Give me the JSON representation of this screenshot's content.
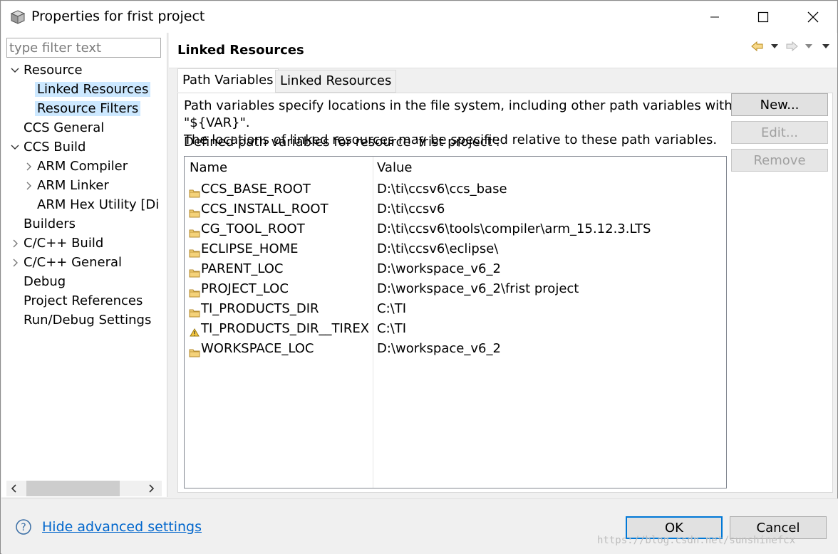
{
  "window": {
    "title": "Properties for frist project",
    "icon": "app-cube-icon"
  },
  "filter": {
    "placeholder": "type filter text"
  },
  "tree": [
    {
      "label": "Resource",
      "expander": "expanded"
    },
    {
      "label": "Linked Resources",
      "selected": true
    },
    {
      "label": "Resource Filters",
      "selected": true
    },
    {
      "label": "CCS General"
    },
    {
      "label": "CCS Build",
      "expander": "expanded"
    },
    {
      "label": "ARM Compiler",
      "expander": "collapsed"
    },
    {
      "label": "ARM Linker",
      "expander": "collapsed"
    },
    {
      "label": "ARM Hex Utility  [Di"
    },
    {
      "label": "Builders"
    },
    {
      "label": "C/C++ Build",
      "expander": "collapsed"
    },
    {
      "label": "C/C++ General",
      "expander": "collapsed"
    },
    {
      "label": "Debug"
    },
    {
      "label": "Project References"
    },
    {
      "label": "Run/Debug Settings"
    }
  ],
  "page": {
    "title": "Linked Resources",
    "nav_icons": [
      "back-arrow-icon",
      "dropdown-icon",
      "forward-arrow-icon",
      "dropdown-icon",
      "menu-dropdown-icon"
    ]
  },
  "tabs": [
    {
      "label": "Path Variables",
      "active": true
    },
    {
      "label": "Linked Resources",
      "active": false
    }
  ],
  "panel": {
    "description_line1": "Path variables specify locations in the file system, including other path variables with the syntax \"${VAR}\".",
    "description_line2": "The locations of linked resources may be specified relative to these path variables.",
    "defined_label": "Defined path variables for resource 'frist project':"
  },
  "table": {
    "columns": [
      "Name",
      "Value"
    ],
    "rows": [
      {
        "name": "CCS_BASE_ROOT",
        "value": "D:\\ti\\ccsv6\\ccs_base",
        "icon": "folder-icon"
      },
      {
        "name": "CCS_INSTALL_ROOT",
        "value": "D:\\ti\\ccsv6",
        "icon": "folder-icon"
      },
      {
        "name": "CG_TOOL_ROOT",
        "value": "D:\\ti\\ccsv6\\tools\\compiler\\arm_15.12.3.LTS",
        "icon": "folder-icon"
      },
      {
        "name": "ECLIPSE_HOME",
        "value": "D:\\ti\\ccsv6\\eclipse\\",
        "icon": "folder-icon"
      },
      {
        "name": "PARENT_LOC",
        "value": "D:\\workspace_v6_2",
        "icon": "folder-icon"
      },
      {
        "name": "PROJECT_LOC",
        "value": "D:\\workspace_v6_2\\frist project",
        "icon": "folder-icon"
      },
      {
        "name": "TI_PRODUCTS_DIR",
        "value": "C:\\TI",
        "icon": "folder-icon"
      },
      {
        "name": "TI_PRODUCTS_DIR__TIREX",
        "value": "C:\\TI",
        "icon": "warning-icon"
      },
      {
        "name": "WORKSPACE_LOC",
        "value": "D:\\workspace_v6_2",
        "icon": "folder-icon"
      }
    ]
  },
  "buttons": {
    "new": "New...",
    "edit": "Edit...",
    "remove": "Remove",
    "ok": "OK",
    "cancel": "Cancel"
  },
  "footer": {
    "help_link": "Hide advanced settings",
    "watermark": "https://blog.csdn.net/sunshinefcx"
  },
  "colors": {
    "selection": "#cce8ff",
    "link": "#0066cc",
    "default_button_border": "#0078d7"
  }
}
